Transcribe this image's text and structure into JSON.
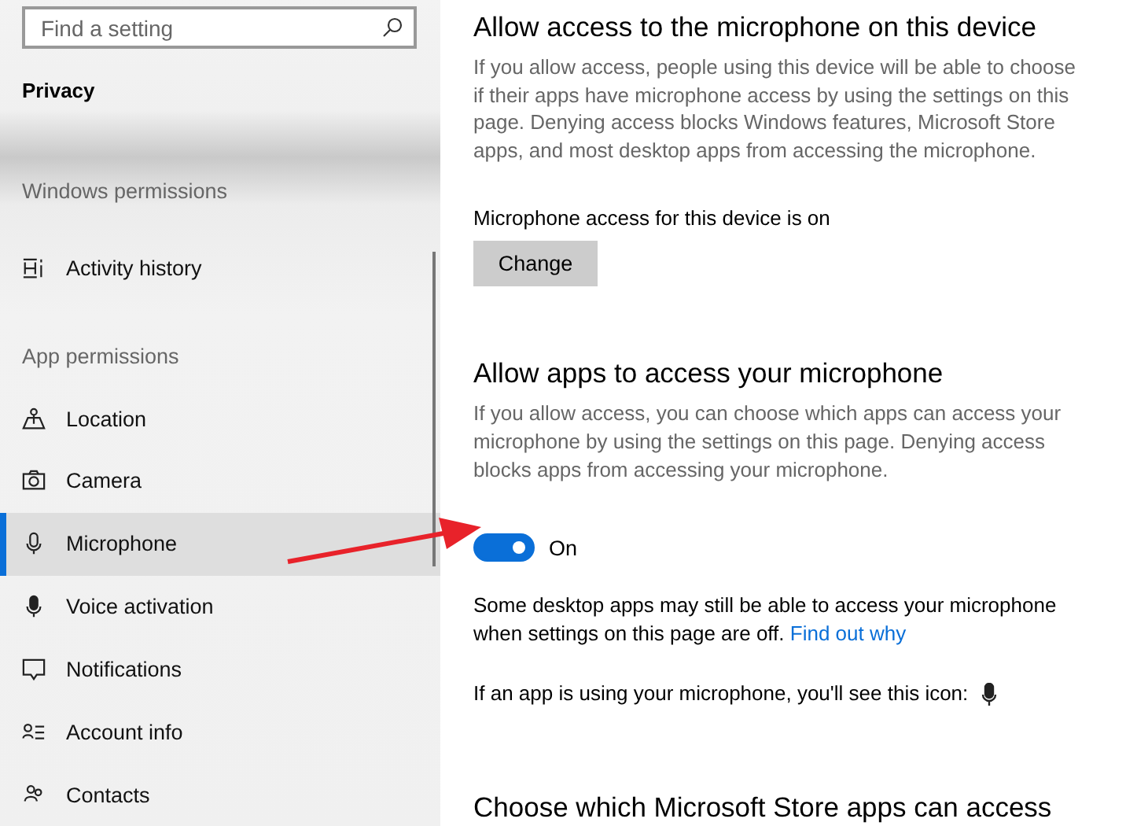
{
  "search": {
    "placeholder": "Find a setting"
  },
  "sidebar": {
    "title": "Privacy",
    "sections": [
      {
        "heading": "Windows permissions",
        "items": [
          {
            "label": "Activity history",
            "kind": "activity",
            "selected": false
          }
        ]
      },
      {
        "heading": "App permissions",
        "items": [
          {
            "label": "Location",
            "kind": "location",
            "selected": false
          },
          {
            "label": "Camera",
            "kind": "camera",
            "selected": false
          },
          {
            "label": "Microphone",
            "kind": "microphone",
            "selected": true
          },
          {
            "label": "Voice activation",
            "kind": "voice",
            "selected": false
          },
          {
            "label": "Notifications",
            "kind": "notifications",
            "selected": false
          },
          {
            "label": "Account info",
            "kind": "account",
            "selected": false
          },
          {
            "label": "Contacts",
            "kind": "contacts",
            "selected": false
          }
        ]
      }
    ]
  },
  "device_access": {
    "title": "Allow access to the microphone on this device",
    "description": "If you allow access, people using this device will be able to choose if their apps have microphone access by using the settings on this page. Denying access blocks Windows features, Microsoft Store apps, and most desktop apps from accessing the microphone.",
    "status": "Microphone access for this device is on",
    "button": "Change"
  },
  "app_access": {
    "title": "Allow apps to access your microphone",
    "description": "If you allow access, you can choose which apps can access your microphone by using the settings on this page. Denying access blocks apps from accessing your microphone.",
    "toggle": {
      "on": true,
      "label": "On"
    },
    "note": "Some desktop apps may still be able to access your microphone when settings on this page are off.",
    "link": "Find out why",
    "icon_note": "If an app is using your microphone, you'll see this icon:"
  },
  "store_apps": {
    "title": "Choose which Microsoft Store apps can access"
  }
}
